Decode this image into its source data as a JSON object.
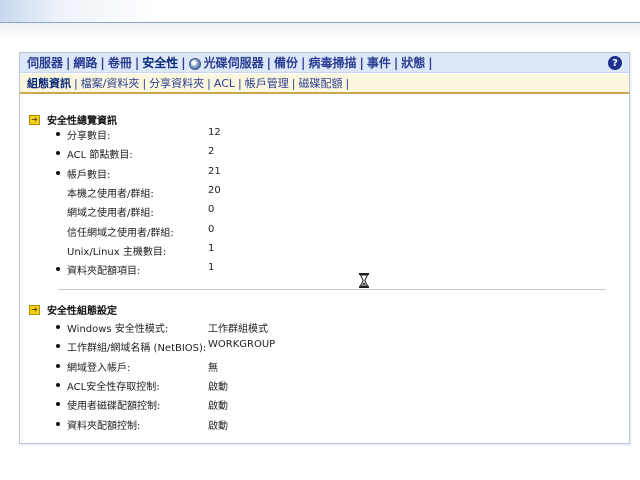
{
  "nav_primary": {
    "tabs": [
      "伺服器",
      "網路",
      "卷冊",
      "安全性",
      "光碟伺服器",
      "備份",
      "病毒掃描",
      "事件",
      "狀態"
    ],
    "active": "安全性"
  },
  "nav_secondary": {
    "tabs": [
      "組態資訊",
      "檔案/資料夾",
      "分享資料夾",
      "ACL",
      "帳戶管理",
      "磁碟配額"
    ],
    "active": "組態資訊"
  },
  "help_label": "?",
  "overview": {
    "title": "安全性總覽資訊",
    "rows": [
      {
        "label": "分享數目:",
        "value": "12",
        "bullet": true
      },
      {
        "label": "ACL 節點數目:",
        "value": "2",
        "bullet": true
      },
      {
        "label": "帳戶數目:",
        "value": "21",
        "bullet": true
      },
      {
        "label": "本機之使用者/群組:",
        "value": "20",
        "bullet": false
      },
      {
        "label": "網域之使用者/群組:",
        "value": "0",
        "bullet": false
      },
      {
        "label": "信任網域之使用者/群組:",
        "value": "0",
        "bullet": false
      },
      {
        "label": "Unix/Linux 主機數目:",
        "value": "1",
        "bullet": false
      },
      {
        "label": "資料夾配額項目:",
        "value": "1",
        "bullet": true
      }
    ]
  },
  "settings": {
    "title": "安全性組態設定",
    "rows": [
      {
        "label": "Windows 安全性模式:",
        "value": "工作群組模式"
      },
      {
        "label": "工作群組/網域名稱 (NetBIOS):",
        "value": "WORKGROUP"
      },
      {
        "label": "網域登入帳戶:",
        "value": "無"
      },
      {
        "label": "ACL安全性存取控制:",
        "value": "啟動"
      },
      {
        "label": "使用者磁碟配額控制:",
        "value": "啟動"
      },
      {
        "label": "資料夾配額控制:",
        "value": "啟動"
      }
    ]
  },
  "colors": {
    "nav_primary_bg": "#dce8f8",
    "nav_secondary_bg": "#fbf6de",
    "link": "#2c3f93",
    "accent_gold": "#caa94d"
  },
  "icons": {
    "disk": "cd-server-icon",
    "help": "help-icon",
    "section": "arrow-right-icon",
    "busy": "hourglass-icon"
  }
}
